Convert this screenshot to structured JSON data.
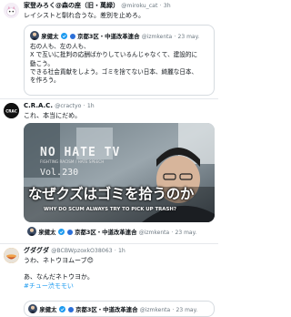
{
  "tweets": [
    {
      "display_name": "家登みろく@森の座（旧・萬緑）",
      "handle": "@miroku_cat",
      "age": "3h",
      "text_lines": [
        "レイシストと馴れ合うな。差別を止めろ。"
      ],
      "quote": {
        "display_name": "泉健太",
        "affiliation": "京都3区・中道改革連合",
        "handle": "@izmkenta",
        "date": "23 may.",
        "text_lines": [
          "右の人も、左の人も、",
          "X で互いに批判の応酬ばかりしているんじゃなくて、建設的に",
          "動こう。",
          "できる社会貢献をしよう。ゴミを捨てない日本、綺麗な日本、",
          "を作ろう。"
        ]
      }
    },
    {
      "display_name": "C.R.A.C.",
      "handle": "@cractyo",
      "age": "1h",
      "text_lines": [
        "これ、本当にだめ。"
      ],
      "video": {
        "overlay_title": "NO HATE TV",
        "overlay_sub": "FIGHTING RACISM / HATE SPEECH",
        "overlay_vol": "Vol.230",
        "caption_jp": "なぜクズはゴミを拾うのか",
        "caption_en": "WHY DO SCUM ALWAYS TRY TO PICK UP TRASH?"
      },
      "quote": {
        "display_name": "泉健太",
        "affiliation": "京都3区・中道改革連合",
        "handle": "@izmkenta",
        "date": "23 may."
      }
    },
    {
      "display_name": "グダグダ",
      "handle": "@BCBWpzoxkO38063",
      "age": "1h",
      "text_lines": [
        "うわ、ネトウヨムーブ😊",
        "",
        "あ、なんだネトウヨか。"
      ],
      "hashtag": "#チュー渋モモい",
      "quote": {
        "display_name": "泉健太",
        "affiliation": "京都3区・中道改革連合",
        "handle": "@izmkenta",
        "date": "23 may."
      }
    }
  ],
  "colors": {
    "link": "#1d9bf0",
    "verified": "#1d9bf0",
    "muted": "#6b7780",
    "border": "#d6dbe0"
  },
  "icons": [
    "verified-icon",
    "flag-icon"
  ]
}
